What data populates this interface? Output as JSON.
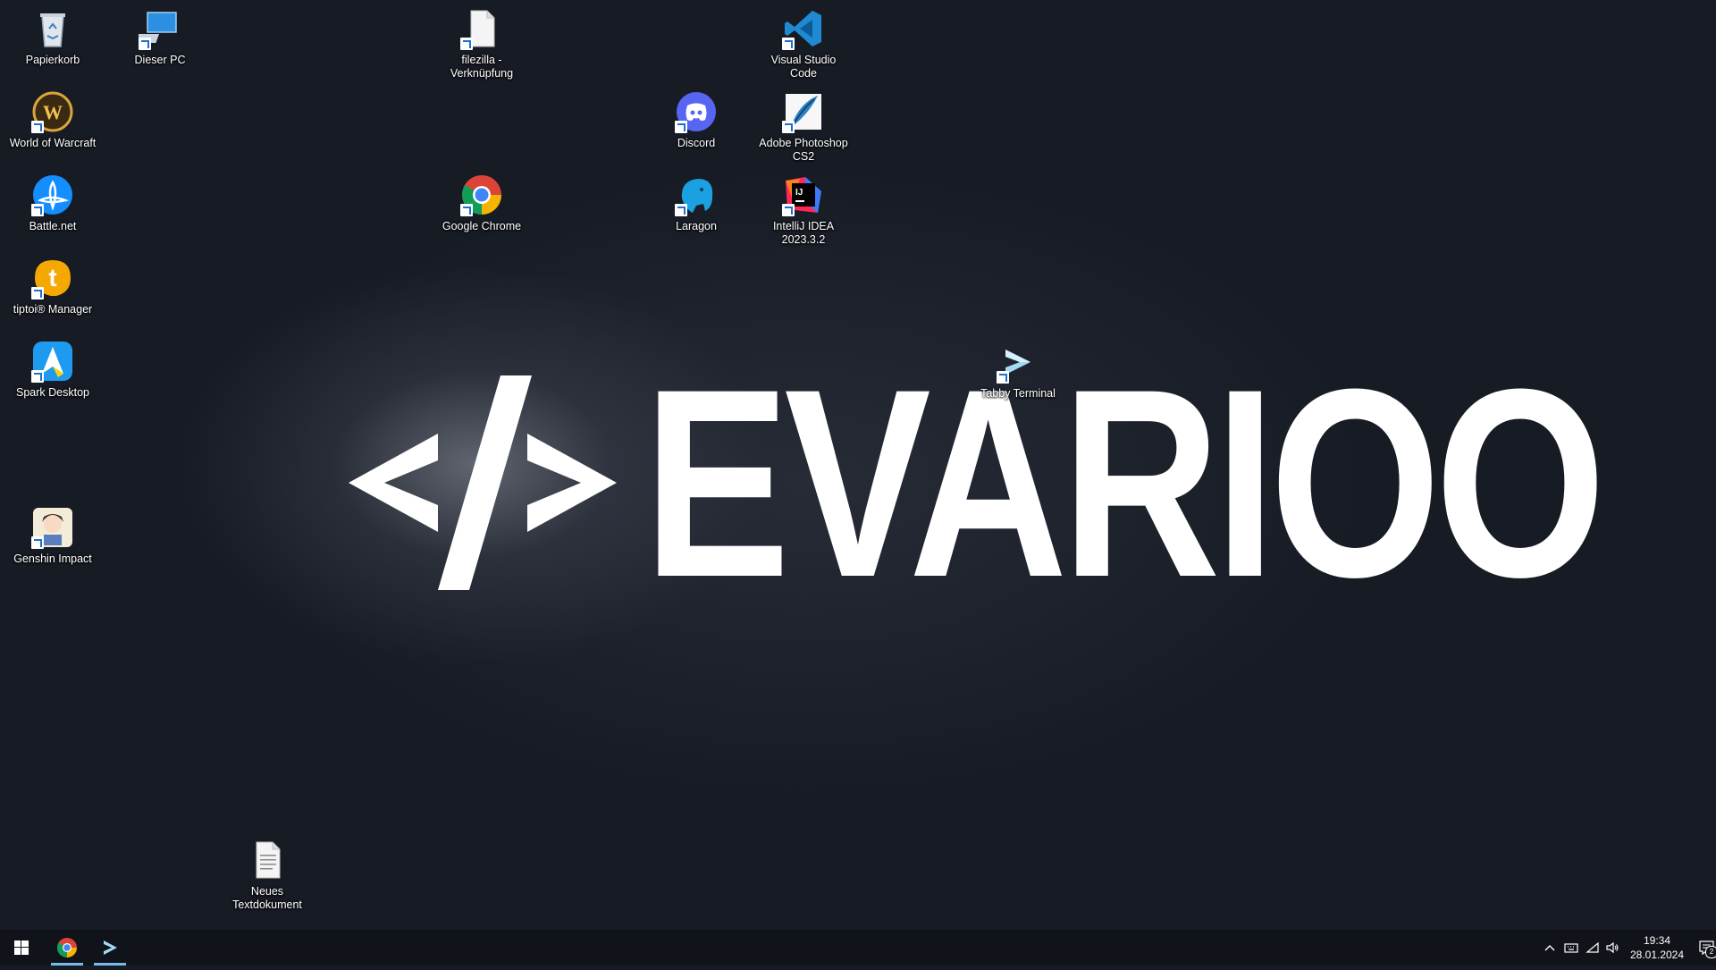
{
  "wallpaper": {
    "code_glyph": "</>",
    "brand": "EVARIOO"
  },
  "desktop_icons": [
    {
      "label": "Papierkorb"
    },
    {
      "label": "Dieser PC"
    },
    {
      "label": "filezilla - Verknüpfung"
    },
    {
      "label": "Visual Studio Code"
    },
    {
      "label": "World of Warcraft"
    },
    {
      "label": "Discord"
    },
    {
      "label": "Adobe Photoshop CS2"
    },
    {
      "label": "Battle.net"
    },
    {
      "label": "Google Chrome"
    },
    {
      "label": "Laragon"
    },
    {
      "label": "IntelliJ IDEA 2023.3.2"
    },
    {
      "label": "tiptoi® Manager"
    },
    {
      "label": "Tabby Terminal"
    },
    {
      "label": "Spark Desktop"
    },
    {
      "label": "Genshin Impact"
    },
    {
      "label": "Neues Textdokument"
    }
  ],
  "taskbar": {
    "pinned": [
      "start-icon",
      "chrome-icon",
      "tabby-icon"
    ],
    "tray": {
      "time": "19:34",
      "date": "28.01.2024",
      "notification_count": "2"
    }
  },
  "colors": {
    "desktop_bg": "#171b24",
    "taskbar_bg": "#101319",
    "active_underline": "#76b9ed"
  }
}
